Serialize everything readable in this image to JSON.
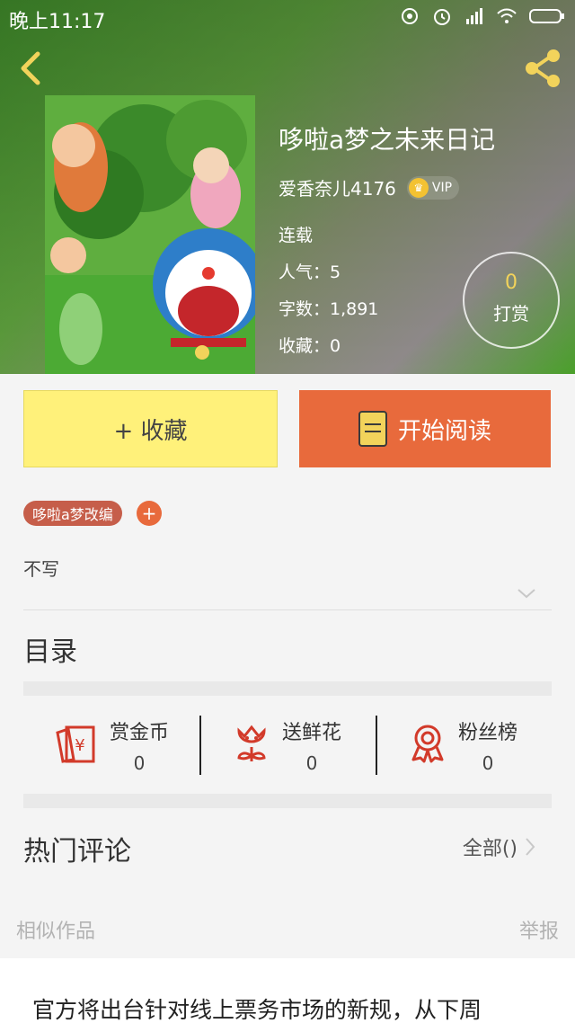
{
  "status_bar": {
    "time": "晚上11:17",
    "icons": [
      "sync-icon",
      "alarm-icon",
      "signal-icon",
      "wifi-icon",
      "battery-icon"
    ]
  },
  "header": {
    "back_icon": "chevron-left-icon",
    "share_icon": "share-icon"
  },
  "book": {
    "title": "哆啦a梦之未来日记",
    "author": "爱香奈儿4176",
    "vip_badge": "VIP",
    "status": "连载",
    "popularity": "人气：5",
    "word_count": "字数：1,891",
    "favorites": "收藏：0",
    "tip_count": "0",
    "tip_label": "打赏"
  },
  "actions": {
    "collect_label": "+ 收藏",
    "read_label": "开始阅读"
  },
  "tags": {
    "items": [
      "哆啦a梦改编"
    ],
    "add_label": "+"
  },
  "description": "不写",
  "toc_title": "目录",
  "stats": [
    {
      "label": "赏金币",
      "value": "0",
      "icon": "coin-envelope-icon"
    },
    {
      "label": "送鲜花",
      "value": "0",
      "icon": "flower-icon"
    },
    {
      "label": "粉丝榜",
      "value": "0",
      "icon": "medal-icon"
    }
  ],
  "comments": {
    "title": "热门评论",
    "all_label": "全部()"
  },
  "similar": {
    "title": "相似作品",
    "report": "举报"
  },
  "news_line": "官方将出台针对线上票务市场的新规，从下周",
  "colors": {
    "accent_orange": "#e86a3c",
    "collect_yellow": "#fff17a",
    "tag_color": "#c65e4a"
  }
}
